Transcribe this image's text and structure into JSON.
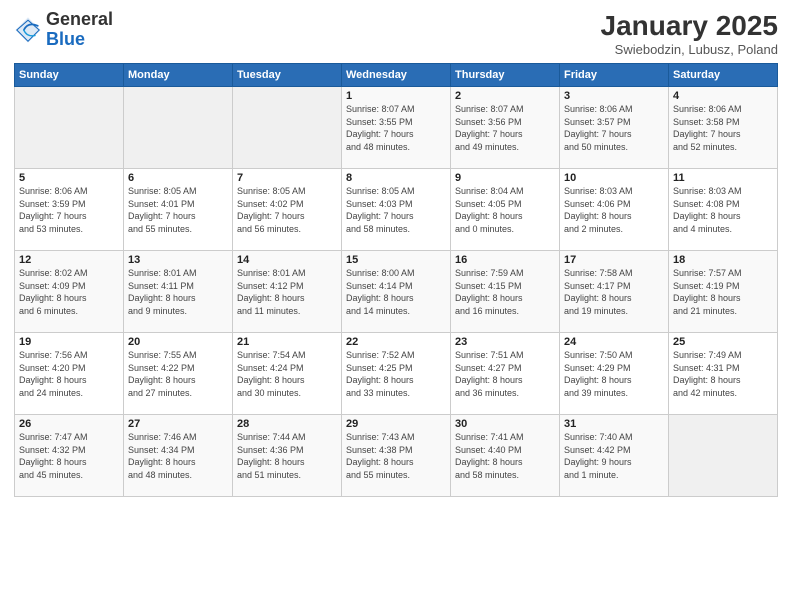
{
  "logo": {
    "general": "General",
    "blue": "Blue"
  },
  "header": {
    "title": "January 2025",
    "subtitle": "Swiebodzin, Lubusz, Poland"
  },
  "weekdays": [
    "Sunday",
    "Monday",
    "Tuesday",
    "Wednesday",
    "Thursday",
    "Friday",
    "Saturday"
  ],
  "weeks": [
    [
      {
        "day": "",
        "info": ""
      },
      {
        "day": "",
        "info": ""
      },
      {
        "day": "",
        "info": ""
      },
      {
        "day": "1",
        "info": "Sunrise: 8:07 AM\nSunset: 3:55 PM\nDaylight: 7 hours\nand 48 minutes."
      },
      {
        "day": "2",
        "info": "Sunrise: 8:07 AM\nSunset: 3:56 PM\nDaylight: 7 hours\nand 49 minutes."
      },
      {
        "day": "3",
        "info": "Sunrise: 8:06 AM\nSunset: 3:57 PM\nDaylight: 7 hours\nand 50 minutes."
      },
      {
        "day": "4",
        "info": "Sunrise: 8:06 AM\nSunset: 3:58 PM\nDaylight: 7 hours\nand 52 minutes."
      }
    ],
    [
      {
        "day": "5",
        "info": "Sunrise: 8:06 AM\nSunset: 3:59 PM\nDaylight: 7 hours\nand 53 minutes."
      },
      {
        "day": "6",
        "info": "Sunrise: 8:05 AM\nSunset: 4:01 PM\nDaylight: 7 hours\nand 55 minutes."
      },
      {
        "day": "7",
        "info": "Sunrise: 8:05 AM\nSunset: 4:02 PM\nDaylight: 7 hours\nand 56 minutes."
      },
      {
        "day": "8",
        "info": "Sunrise: 8:05 AM\nSunset: 4:03 PM\nDaylight: 7 hours\nand 58 minutes."
      },
      {
        "day": "9",
        "info": "Sunrise: 8:04 AM\nSunset: 4:05 PM\nDaylight: 8 hours\nand 0 minutes."
      },
      {
        "day": "10",
        "info": "Sunrise: 8:03 AM\nSunset: 4:06 PM\nDaylight: 8 hours\nand 2 minutes."
      },
      {
        "day": "11",
        "info": "Sunrise: 8:03 AM\nSunset: 4:08 PM\nDaylight: 8 hours\nand 4 minutes."
      }
    ],
    [
      {
        "day": "12",
        "info": "Sunrise: 8:02 AM\nSunset: 4:09 PM\nDaylight: 8 hours\nand 6 minutes."
      },
      {
        "day": "13",
        "info": "Sunrise: 8:01 AM\nSunset: 4:11 PM\nDaylight: 8 hours\nand 9 minutes."
      },
      {
        "day": "14",
        "info": "Sunrise: 8:01 AM\nSunset: 4:12 PM\nDaylight: 8 hours\nand 11 minutes."
      },
      {
        "day": "15",
        "info": "Sunrise: 8:00 AM\nSunset: 4:14 PM\nDaylight: 8 hours\nand 14 minutes."
      },
      {
        "day": "16",
        "info": "Sunrise: 7:59 AM\nSunset: 4:15 PM\nDaylight: 8 hours\nand 16 minutes."
      },
      {
        "day": "17",
        "info": "Sunrise: 7:58 AM\nSunset: 4:17 PM\nDaylight: 8 hours\nand 19 minutes."
      },
      {
        "day": "18",
        "info": "Sunrise: 7:57 AM\nSunset: 4:19 PM\nDaylight: 8 hours\nand 21 minutes."
      }
    ],
    [
      {
        "day": "19",
        "info": "Sunrise: 7:56 AM\nSunset: 4:20 PM\nDaylight: 8 hours\nand 24 minutes."
      },
      {
        "day": "20",
        "info": "Sunrise: 7:55 AM\nSunset: 4:22 PM\nDaylight: 8 hours\nand 27 minutes."
      },
      {
        "day": "21",
        "info": "Sunrise: 7:54 AM\nSunset: 4:24 PM\nDaylight: 8 hours\nand 30 minutes."
      },
      {
        "day": "22",
        "info": "Sunrise: 7:52 AM\nSunset: 4:25 PM\nDaylight: 8 hours\nand 33 minutes."
      },
      {
        "day": "23",
        "info": "Sunrise: 7:51 AM\nSunset: 4:27 PM\nDaylight: 8 hours\nand 36 minutes."
      },
      {
        "day": "24",
        "info": "Sunrise: 7:50 AM\nSunset: 4:29 PM\nDaylight: 8 hours\nand 39 minutes."
      },
      {
        "day": "25",
        "info": "Sunrise: 7:49 AM\nSunset: 4:31 PM\nDaylight: 8 hours\nand 42 minutes."
      }
    ],
    [
      {
        "day": "26",
        "info": "Sunrise: 7:47 AM\nSunset: 4:32 PM\nDaylight: 8 hours\nand 45 minutes."
      },
      {
        "day": "27",
        "info": "Sunrise: 7:46 AM\nSunset: 4:34 PM\nDaylight: 8 hours\nand 48 minutes."
      },
      {
        "day": "28",
        "info": "Sunrise: 7:44 AM\nSunset: 4:36 PM\nDaylight: 8 hours\nand 51 minutes."
      },
      {
        "day": "29",
        "info": "Sunrise: 7:43 AM\nSunset: 4:38 PM\nDaylight: 8 hours\nand 55 minutes."
      },
      {
        "day": "30",
        "info": "Sunrise: 7:41 AM\nSunset: 4:40 PM\nDaylight: 8 hours\nand 58 minutes."
      },
      {
        "day": "31",
        "info": "Sunrise: 7:40 AM\nSunset: 4:42 PM\nDaylight: 9 hours\nand 1 minute."
      },
      {
        "day": "",
        "info": ""
      }
    ]
  ]
}
